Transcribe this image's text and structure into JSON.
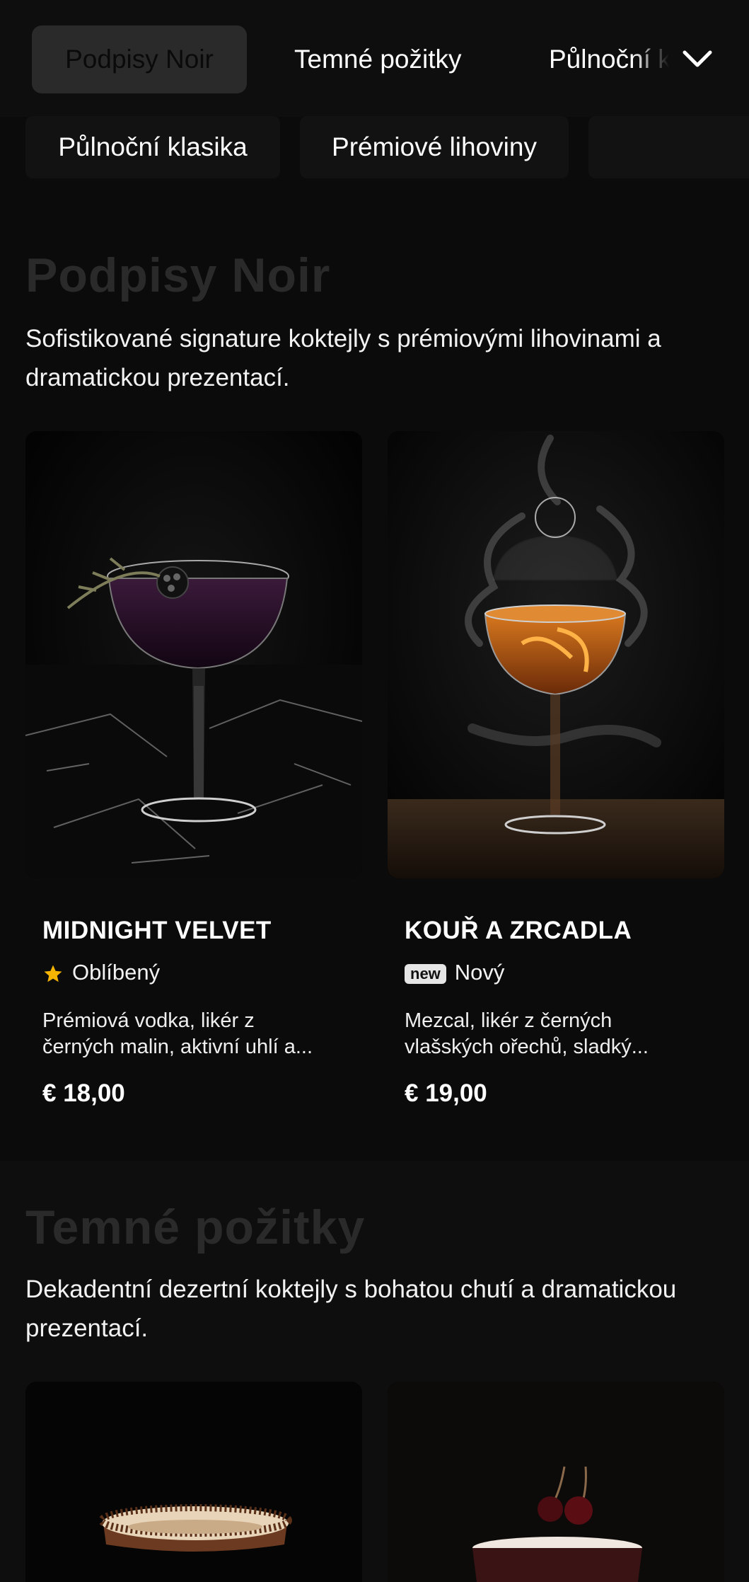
{
  "nav": {
    "tabs": [
      {
        "label": "Podpisy Noir",
        "active": true
      },
      {
        "label": "Temné požitky",
        "active": false
      },
      {
        "label": "Půlnoční klasika",
        "active": false
      }
    ],
    "chips": [
      "Půlnoční klasika",
      "Prémiové lihoviny"
    ],
    "expand_icon": "chevron-down-icon"
  },
  "sections": [
    {
      "title": "Podpisy Noir",
      "description": "Sofistikované signature koktejly s prémiovými lihovinami a dramatickou prezentací.",
      "items": [
        {
          "name": "MIDNIGHT VELVET",
          "tag_icon": "star-icon",
          "tag": "Oblíbený",
          "description_line1": "Prémiová vodka, likér z",
          "description_line2": "černých malin, aktivní uhlí a...",
          "price": "€ 18,00"
        },
        {
          "name": "KOUŘ A ZRCADLA",
          "tag_badge": "new",
          "tag": "Nový",
          "description_line1": "Mezcal, likér z černých",
          "description_line2": "vlašských ořechů, sladký...",
          "price": "€ 19,00"
        }
      ]
    },
    {
      "title": "Temné požitky",
      "description": "Dekadentní dezertní koktejly s bohatou chutí a dramatickou prezentací."
    }
  ],
  "colors": {
    "background": "#0b0b0b",
    "active_tab": "#2a2a2a",
    "section_title": "#2a2a2a",
    "star": "#f5b400",
    "text": "#f2f2f2"
  }
}
